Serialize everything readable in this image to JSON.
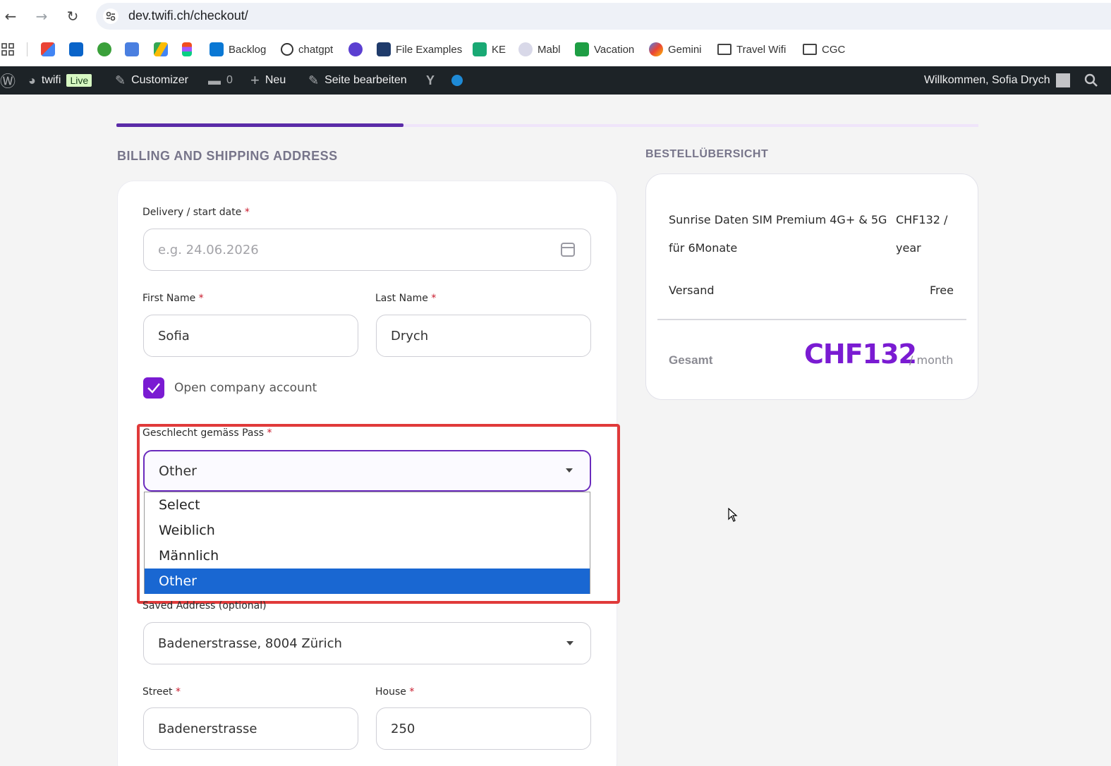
{
  "browser": {
    "url": "dev.twifi.ch/checkout/",
    "bookmarks": [
      {
        "label": "",
        "icon": "gmail-icon"
      },
      {
        "label": "",
        "icon": "outlook-icon"
      },
      {
        "label": "",
        "icon": "app-icon"
      },
      {
        "label": "",
        "icon": "translate-icon"
      },
      {
        "label": "",
        "icon": "drive-icon"
      },
      {
        "label": "",
        "icon": "figma-icon"
      },
      {
        "label": "Backlog",
        "icon": "azure-devops-icon"
      },
      {
        "label": "chatgpt",
        "icon": "chatgpt-icon"
      },
      {
        "label": "",
        "icon": "planet-icon"
      },
      {
        "label": "File Examples",
        "icon": "file-examples-icon"
      },
      {
        "label": "KE",
        "icon": "ke-icon"
      },
      {
        "label": "Mabl",
        "icon": "mabl-icon"
      },
      {
        "label": "Vacation",
        "icon": "vacation-icon"
      },
      {
        "label": "Gemini",
        "icon": "gemini-icon"
      },
      {
        "label": "Travel Wifi",
        "icon": "folder-icon"
      },
      {
        "label": "CGC",
        "icon": "folder-icon"
      }
    ]
  },
  "wp_bar": {
    "site": "twifi",
    "live": "Live",
    "customizer": "Customizer",
    "comments": "0",
    "new": "Neu",
    "edit": "Seite bearbeiten",
    "welcome": "Willkommen, Sofia Drych"
  },
  "billing": {
    "title": "BILLING AND SHIPPING ADDRESS",
    "delivery_label": "Delivery / start date",
    "delivery_placeholder": "e.g. 24.06.2026",
    "first_name_label": "First Name",
    "first_name": "Sofia",
    "last_name_label": "Last Name",
    "last_name": "Drych",
    "company_label": "Open company account",
    "gender_label": "Geschlecht gemäss Pass",
    "gender_value": "Other",
    "gender_options": [
      "Select",
      "Weiblich",
      "Männlich",
      "Other"
    ],
    "saved_address_label": "Saved Address (optional)",
    "saved_address": "Badenerstrasse, 8004 Zürich",
    "street_label": "Street",
    "street": "Badenerstrasse",
    "house_label": "House",
    "house": "250",
    "required_mark": "*"
  },
  "summary": {
    "title": "BESTELLÜBERSICHT",
    "product_line1": "Sunrise Daten SIM Premium 4G+ & 5G",
    "product_line2": "für 6Monate",
    "price_line1": "CHF132 /",
    "price_line2": "year",
    "shipping_label": "Versand",
    "shipping_value": "Free",
    "total_label": "Gesamt",
    "total_value": "CHF132",
    "total_period": "/ month"
  },
  "colors": {
    "accent": "#7a1bd2",
    "progress": "#5b2ba8",
    "highlight": "#e03a3a",
    "dropdown_selected": "#1967d2"
  }
}
